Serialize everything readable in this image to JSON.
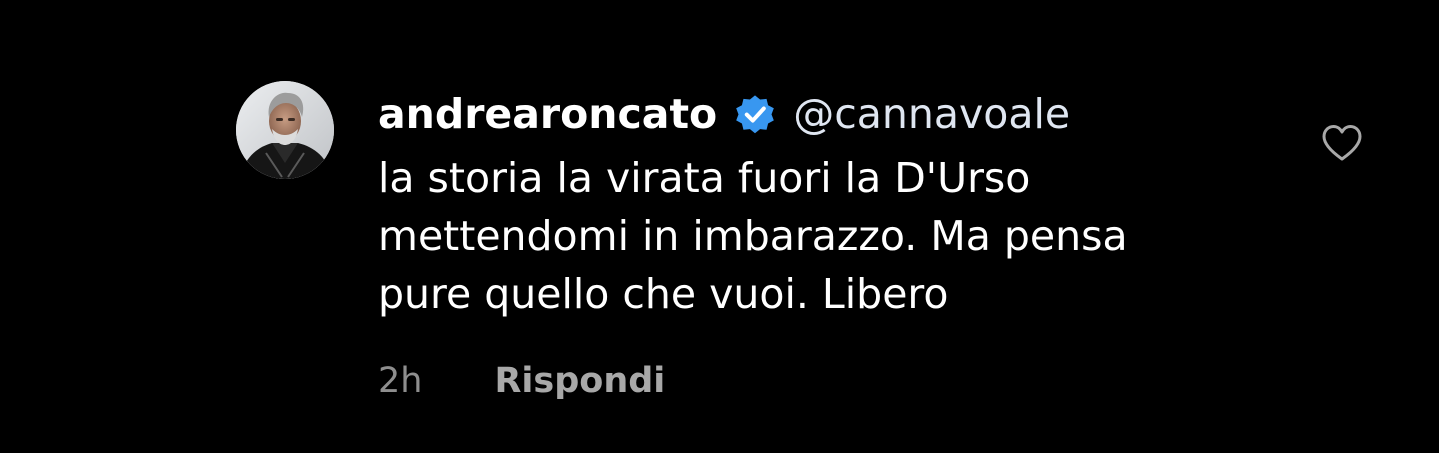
{
  "comment": {
    "username": "andrearoncato",
    "verified_icon": "verified-badge-icon",
    "verified_color": "#3897f0",
    "mention": "@cannavoale",
    "text_lines": [
      "la storia la virata fuori la D'Urso",
      "mettendomi in imbarazzo. Ma pensa",
      "pure quello che vuoi. Libero"
    ],
    "timestamp": "2h",
    "reply_label": "Rispondi",
    "like_icon": "heart-outline-icon",
    "avatar_icon": "profile-photo-avatar"
  },
  "colors": {
    "background": "#000000",
    "text": "#ffffff",
    "secondary_text": "#8e8e8e",
    "reply_text": "#a8a8a8",
    "icon_stroke": "#a8a8a8"
  }
}
